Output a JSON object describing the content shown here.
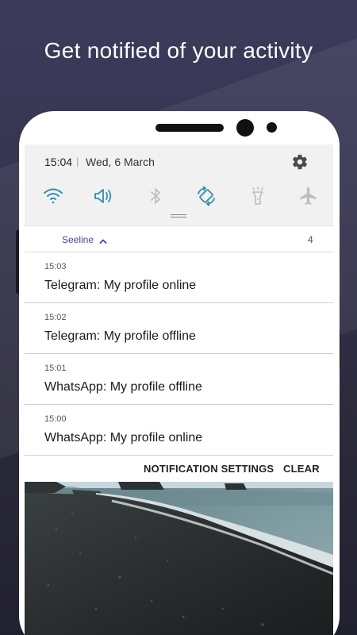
{
  "headline": "Get notified of your activity",
  "status": {
    "time": "15:04",
    "separator": "|",
    "date": "Wed, 6 March",
    "settings_icon": "gear-icon"
  },
  "quick_settings": [
    {
      "name": "wifi",
      "icon": "wifi-icon",
      "active": true
    },
    {
      "name": "sound",
      "icon": "speaker-icon",
      "active": true
    },
    {
      "name": "bluetooth",
      "icon": "bluetooth-icon",
      "active": false
    },
    {
      "name": "auto-rotate",
      "icon": "rotate-icon",
      "active": true
    },
    {
      "name": "flashlight",
      "icon": "flashlight-icon",
      "active": false
    },
    {
      "name": "airplane",
      "icon": "airplane-icon",
      "active": false
    }
  ],
  "group": {
    "app_name": "Seeline",
    "count": "4"
  },
  "notifications": [
    {
      "time": "15:03",
      "text": "Telegram: My profile online"
    },
    {
      "time": "15:02",
      "text": "Telegram: My profile offline"
    },
    {
      "time": "15:01",
      "text": "WhatsApp: My profile offline"
    },
    {
      "time": "15:00",
      "text": "WhatsApp: My profile online"
    }
  ],
  "actions": {
    "settings_label": "NOTIFICATION SETTINGS",
    "clear_label": "CLEAR"
  },
  "colors": {
    "accent_active": "#2f8fb0",
    "inactive": "#b9bdc0",
    "app_name": "#4b3fa0",
    "background": "#35344f"
  }
}
